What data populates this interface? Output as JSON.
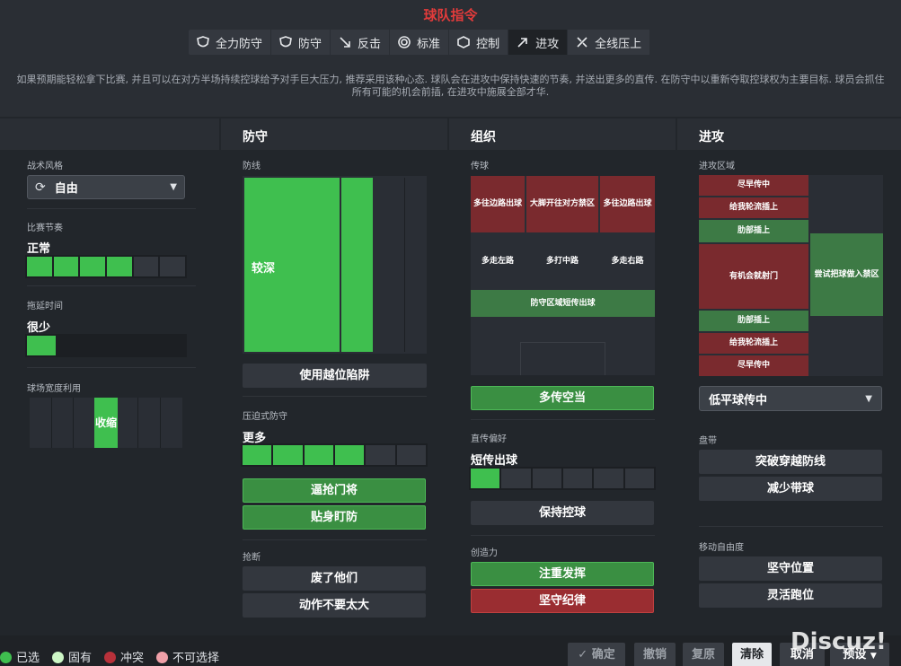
{
  "header": {
    "title": "球队指令",
    "tabs": [
      {
        "label": "全力防守",
        "icon": "shield-star-icon"
      },
      {
        "label": "防守",
        "icon": "shield-icon"
      },
      {
        "label": "反击",
        "icon": "counter-icon"
      },
      {
        "label": "标准",
        "icon": "target-icon"
      },
      {
        "label": "控制",
        "icon": "cube-icon"
      },
      {
        "label": "进攻",
        "icon": "arrow-out-icon"
      },
      {
        "label": "全线压上",
        "icon": "multi-arrow-icon"
      }
    ],
    "active_tab": "进攻",
    "description": "如果预期能轻松拿下比赛, 并且可以在对方半场持续控球给予对手巨大压力, 推荐采用该种心态. 球队会在进攻中保持快速的节奏, 并送出更多的直传. 在防守中以重新夺取控球权为主要目标. 球员会抓住所有可能的机会前插, 在进攻中施展全部才华."
  },
  "general": {
    "mentality_label": "战术风格",
    "mentality_value": "自由",
    "tempo_label": "比赛节奏",
    "tempo_value": "正常",
    "tempo_level": 0.65,
    "timewasting_label": "拖延时间",
    "timewasting_value": "很少",
    "timewasting_level": 0.18,
    "width_label": "球场宽度利用",
    "width_value": "收缩",
    "width_level": 0.3
  },
  "defence": {
    "heading": "防守",
    "line_label": "防线",
    "line_value": "较深",
    "offside_button": "使用越位陷阱",
    "press_label": "压迫式防守",
    "press_value": "更多",
    "press_level": 0.68,
    "press_buttons": [
      "逼抢门将",
      "贴身盯防"
    ],
    "tackle_label": "抢断",
    "tackle_buttons": [
      "废了他们",
      "动作不要太大"
    ]
  },
  "organisation": {
    "heading": "组织",
    "passing_label": "传球",
    "zones": [
      "多往边路出球",
      "大脚开往对方禁区",
      "多往边路出球",
      "多走左路",
      "多打中路",
      "多走右路",
      "防守区域短传出球"
    ],
    "pass_button": "多传空当",
    "directness_label": "直传偏好",
    "directness_value": "短传出球",
    "directness_level": 0.15,
    "keep_ball_button": "保持控球",
    "creativity_label": "创造力",
    "creativity_buttons": [
      "注重发挥",
      "坚守纪律"
    ]
  },
  "attack": {
    "heading": "进攻",
    "zone_label": "进攻区域",
    "zones": [
      "尽早传中",
      "给我轮流插上",
      "肋部插上",
      "有机会就射门",
      "尝试把球做入禁区",
      "肋部插上",
      "给我轮流插上",
      "尽早传中"
    ],
    "cross_select": "低平球传中",
    "dribble_label": "盘带",
    "dribble_buttons": [
      "突破穿越防线",
      "减少带球"
    ],
    "freedom_label": "移动自由度",
    "freedom_buttons": [
      "坚守位置",
      "灵活跑位"
    ]
  },
  "legend": [
    {
      "label": "已选",
      "color": "#3fbf4f"
    },
    {
      "label": "固有",
      "color": "#cdf7c6"
    },
    {
      "label": "冲突",
      "color": "#b8313a"
    },
    {
      "label": "不可选择",
      "color": "#f0a0a8"
    }
  ],
  "footer": {
    "confirm": "确定",
    "undo": "撤销",
    "restore": "复原",
    "clear": "清除",
    "cancel": "取消",
    "preset": "预设",
    "watermark": "Discuz!"
  }
}
